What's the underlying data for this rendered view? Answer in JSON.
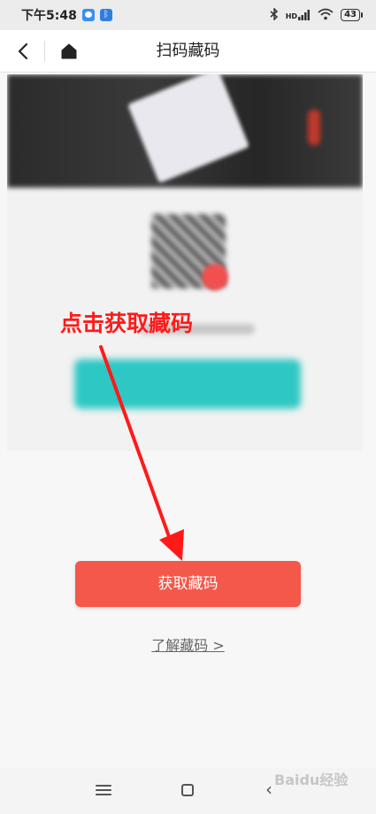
{
  "status_bar": {
    "time": "下午5:48",
    "signal_label": "HD",
    "battery": "43"
  },
  "nav": {
    "title": "扫码藏码"
  },
  "annotation": {
    "text": "点击获取藏码",
    "color": "#ff1a1a"
  },
  "primary_button": {
    "label": "获取藏码",
    "color": "#f4584a"
  },
  "learn_link": {
    "label": "了解藏码 >"
  },
  "watermark": {
    "text": "Baidu经验"
  },
  "colors": {
    "preview_button": "#2ec8c4",
    "accent_red": "#f4584a"
  }
}
